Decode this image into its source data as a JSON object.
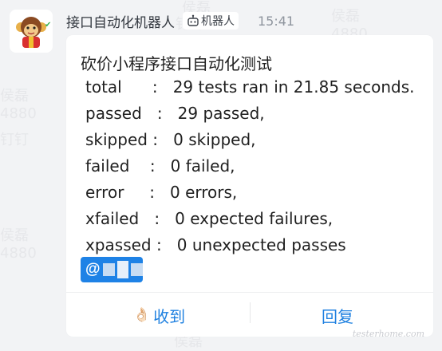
{
  "header": {
    "sender_name": "接口自动化机器人",
    "robot_tag": "机器人",
    "timestamp": "15:41"
  },
  "message": {
    "title": "砍价小程序接口自动化测试",
    "lines": [
      "total      :   29 tests ran in 21.85 seconds.",
      "passed   :   29 passed,",
      "skipped :   0 skipped,",
      "failed    :   0 failed,",
      "error     :   0 errors,",
      "xfailed   :   0 expected failures,",
      "xpassed :   0 unexpected passes"
    ],
    "mention_prefix": "@"
  },
  "actions": {
    "ack_label": "收到",
    "reply_label": "回复"
  },
  "watermark": {
    "name": "侯磊",
    "number": "4880",
    "app": "钉钉"
  },
  "footer_mark": "testerhome.com",
  "colors": {
    "accent": "#1e80e0",
    "mention_bg": "#1e82e6",
    "background": "#f2f3f5",
    "card": "#ffffff"
  },
  "icons": {
    "robot": "robot-icon",
    "ack": "ok-hand-icon",
    "verified": "check-icon"
  }
}
